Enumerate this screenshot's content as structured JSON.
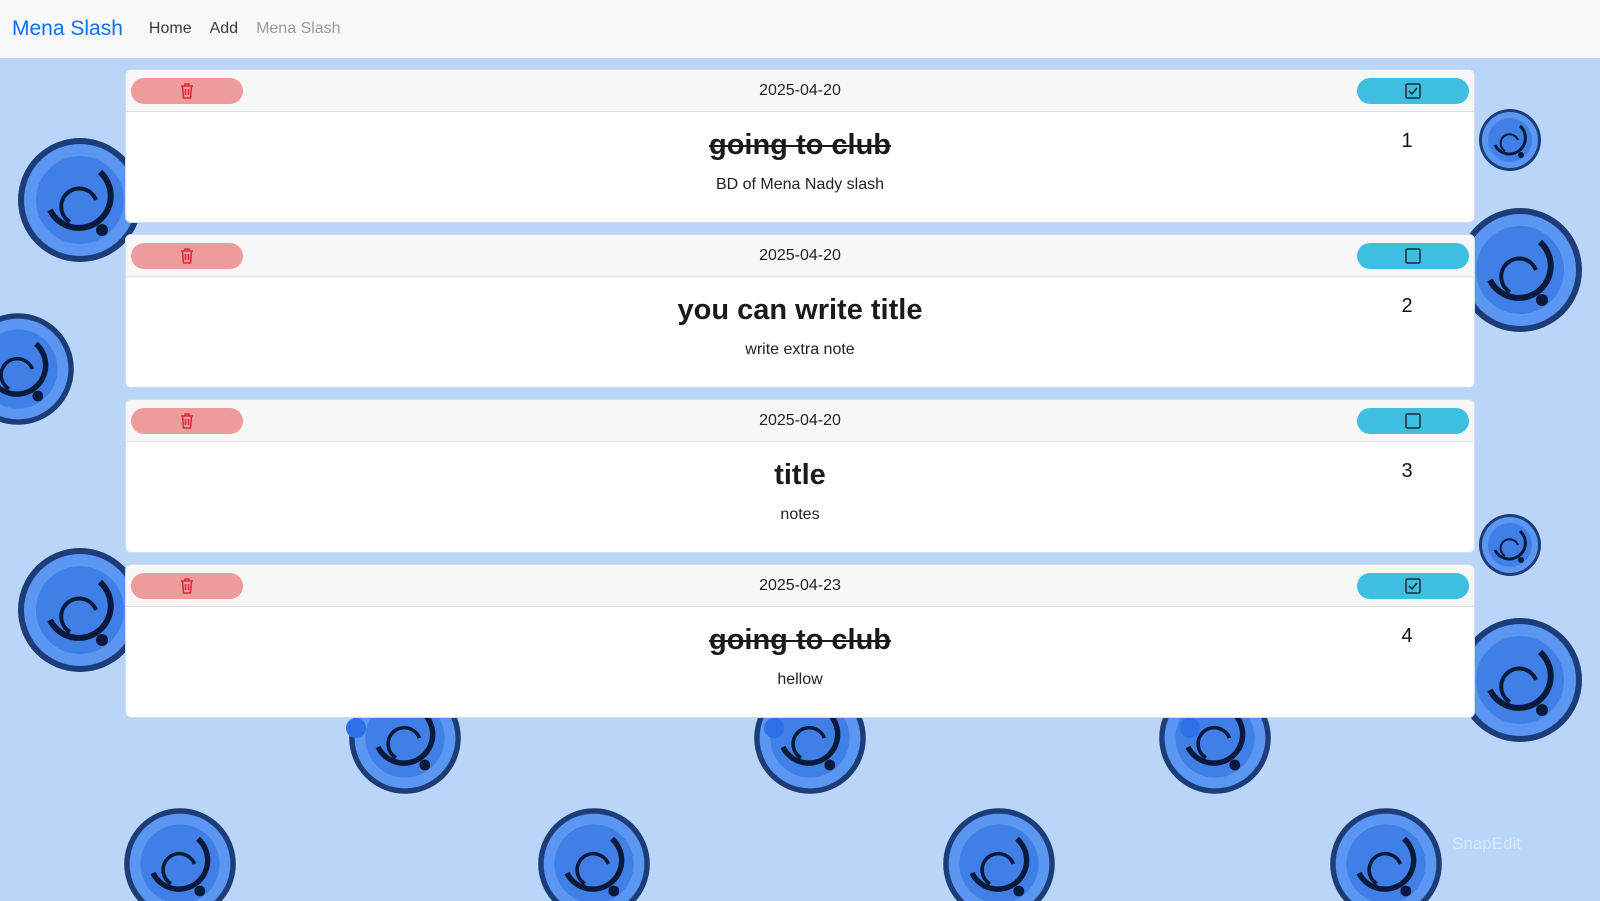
{
  "nav": {
    "brand": "Mena Slash",
    "links": [
      {
        "label": "Home",
        "disabled": false
      },
      {
        "label": "Add",
        "disabled": false
      },
      {
        "label": "Mena Slash",
        "disabled": true
      }
    ]
  },
  "tasks": [
    {
      "date": "2025-04-20",
      "title": "going to club",
      "note": "BD of Mena Nady slash",
      "number": "1",
      "done": true
    },
    {
      "date": "2025-04-20",
      "title": "you can write title",
      "note": "write extra note",
      "number": "2",
      "done": false
    },
    {
      "date": "2025-04-20",
      "title": "title",
      "note": "notes",
      "number": "3",
      "done": false
    },
    {
      "date": "2025-04-23",
      "title": "going to club",
      "note": "hellow",
      "number": "4",
      "done": true
    }
  ],
  "icons": {
    "delete": "trash-icon",
    "checked": "checkbox-checked-icon",
    "unchecked": "checkbox-empty-icon"
  },
  "colors": {
    "brand": "#0d6efd",
    "delete_button": "#ee9b9b",
    "done_button": "#3ebfe0",
    "background": "#b9d5f7"
  },
  "watermark": "SnapEdit"
}
